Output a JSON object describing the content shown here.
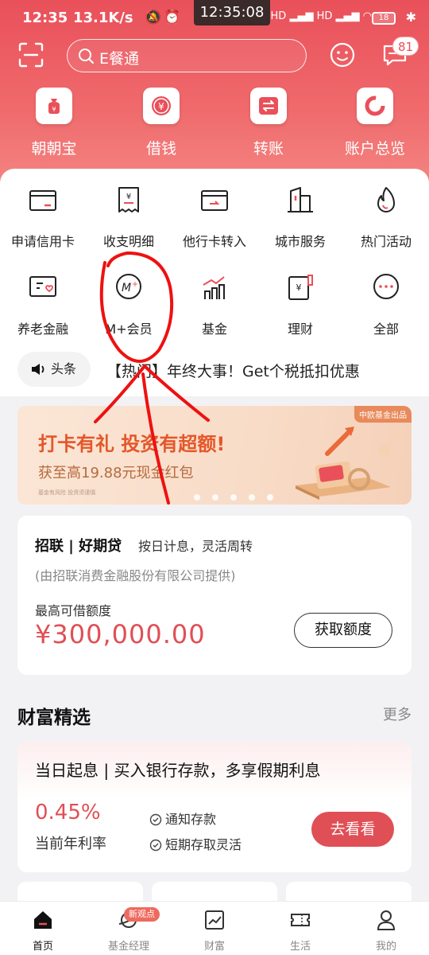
{
  "status_bar": {
    "time": "12:35",
    "net_speed": "13.1K/s",
    "clock_overlay": "12:35:08",
    "signal": "HD",
    "battery": "18"
  },
  "search": {
    "placeholder": "E餐通"
  },
  "message_badge": "81",
  "quick_actions": [
    {
      "label": "朝朝宝",
      "icon": "money-bag-icon"
    },
    {
      "label": "借钱",
      "icon": "yen-coin-icon"
    },
    {
      "label": "转账",
      "icon": "transfer-icon"
    },
    {
      "label": "账户总览",
      "icon": "ring-chart-icon"
    }
  ],
  "services": [
    {
      "label": "申请信用卡",
      "icon": "credit-card-icon"
    },
    {
      "label": "收支明细",
      "icon": "receipt-icon"
    },
    {
      "label": "他行卡转入",
      "icon": "card-transfer-icon"
    },
    {
      "label": "城市服务",
      "icon": "city-building-icon"
    },
    {
      "label": "热门活动",
      "icon": "flame-icon"
    },
    {
      "label": "养老金融",
      "icon": "pension-icon"
    },
    {
      "label": "M+会员",
      "icon": "m-plus-member-icon"
    },
    {
      "label": "基金",
      "icon": "fund-chart-icon"
    },
    {
      "label": "理财",
      "icon": "wealth-doc-icon"
    },
    {
      "label": "全部",
      "icon": "more-dots-icon"
    }
  ],
  "news": {
    "tag": "头条",
    "headline": "【热门】年终大事！Get个税抵扣优惠"
  },
  "banner": {
    "corner": "中欧基金出品",
    "title": "打卡有礼 投资有超额!",
    "subtitle": "获至高19.88元现金红包",
    "note": "基金有风险 投资须谨慎"
  },
  "loan": {
    "brand": "招联 | 好期贷",
    "slogan": "按日计息，灵活周转",
    "provider": "(由招联消费金融股份有限公司提供)",
    "limit_label": "最高可借额度",
    "amount": "¥300,000.00",
    "button": "获取额度"
  },
  "wealth_section": {
    "title": "财富精选",
    "more": "更多",
    "card": {
      "title": "当日起息 | 买入银行存款，多享假期利息",
      "rate": "0.45%",
      "rate_label": "当前年利率",
      "features": [
        "通知存款",
        "短期存取灵活"
      ],
      "button": "去看看"
    }
  },
  "tabs": [
    {
      "label": "首页",
      "icon": "home-icon",
      "active": true
    },
    {
      "label": "基金经理",
      "icon": "planet-icon",
      "active": false
    },
    {
      "label": "财富",
      "icon": "trend-chart-icon",
      "active": false
    },
    {
      "label": "生活",
      "icon": "ticket-icon",
      "active": false
    },
    {
      "label": "我的",
      "icon": "user-icon",
      "active": false
    }
  ],
  "new_pill": "新观点",
  "colors": {
    "brand_red": "#e9505a",
    "accent": "#e04f55"
  }
}
